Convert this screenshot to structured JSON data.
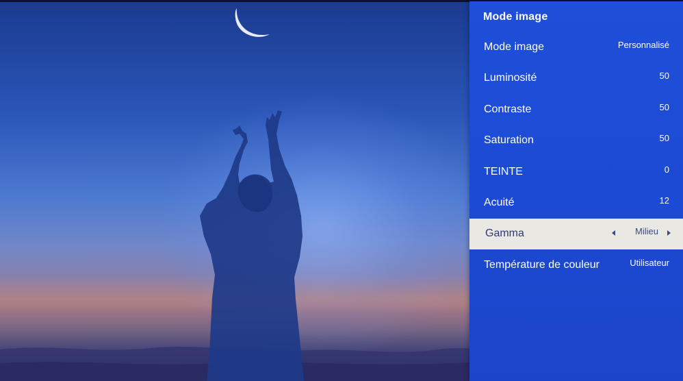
{
  "panel": {
    "title": "Mode image",
    "items": [
      {
        "label": "Mode image",
        "value": "Personnalisé"
      },
      {
        "label": "Luminosité",
        "value": "50"
      },
      {
        "label": "Contraste",
        "value": "50"
      },
      {
        "label": "Saturation",
        "value": "50"
      },
      {
        "label": "TEINTE",
        "value": "0"
      },
      {
        "label": "Acuité",
        "value": "12"
      },
      {
        "label": "Gamma",
        "value": "Milieu",
        "selected": true
      },
      {
        "label": "Température de couleur",
        "value": "Utilisateur"
      }
    ]
  },
  "icons": {
    "gamma_left": "arrow-left-icon",
    "gamma_right": "arrow-right-icon"
  },
  "colors": {
    "panel_bg": "#1f4fd8",
    "selected_bg": "#e9e8e3",
    "selected_text": "#2d3b78",
    "text": "#ffffff"
  }
}
